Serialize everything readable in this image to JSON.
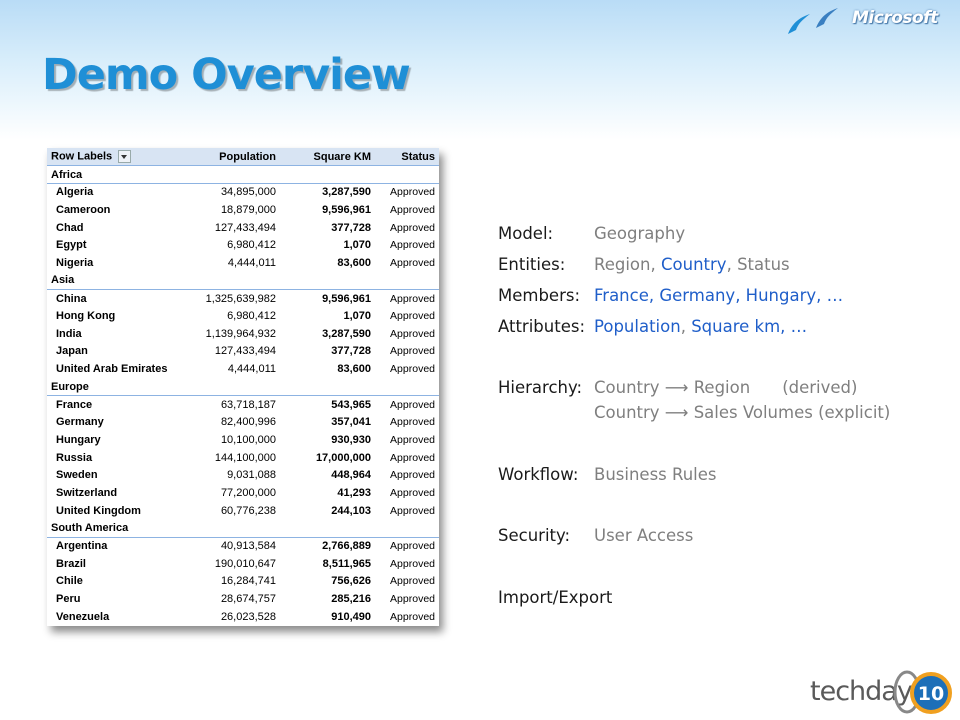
{
  "slide": {
    "title": "Demo Overview",
    "brand": "Microsoft",
    "event_logo": {
      "text": "techdays",
      "number": "10"
    }
  },
  "pivot": {
    "headers": [
      "Row Labels",
      "Population",
      "Square KM",
      "Status"
    ],
    "groups": [
      {
        "region": "Africa",
        "rows": [
          {
            "name": "Algeria",
            "population": "34,895,000",
            "area": "3,287,590",
            "status": "Approved"
          },
          {
            "name": "Cameroon",
            "population": "18,879,000",
            "area": "9,596,961",
            "status": "Approved"
          },
          {
            "name": "Chad",
            "population": "127,433,494",
            "area": "377,728",
            "status": "Approved"
          },
          {
            "name": "Egypt",
            "population": "6,980,412",
            "area": "1,070",
            "status": "Approved"
          },
          {
            "name": "Nigeria",
            "population": "4,444,011",
            "area": "83,600",
            "status": "Approved"
          }
        ]
      },
      {
        "region": "Asia",
        "rows": [
          {
            "name": "China",
            "population": "1,325,639,982",
            "area": "9,596,961",
            "status": "Approved"
          },
          {
            "name": "Hong Kong",
            "population": "6,980,412",
            "area": "1,070",
            "status": "Approved"
          },
          {
            "name": "India",
            "population": "1,139,964,932",
            "area": "3,287,590",
            "status": "Approved"
          },
          {
            "name": "Japan",
            "population": "127,433,494",
            "area": "377,728",
            "status": "Approved"
          },
          {
            "name": "United Arab Emirates",
            "population": "4,444,011",
            "area": "83,600",
            "status": "Approved"
          }
        ]
      },
      {
        "region": "Europe",
        "rows": [
          {
            "name": "France",
            "population": "63,718,187",
            "area": "543,965",
            "status": "Approved"
          },
          {
            "name": "Germany",
            "population": "82,400,996",
            "area": "357,041",
            "status": "Approved"
          },
          {
            "name": "Hungary",
            "population": "10,100,000",
            "area": "930,930",
            "status": "Approved"
          },
          {
            "name": "Russia",
            "population": "144,100,000",
            "area": "17,000,000",
            "status": "Approved"
          },
          {
            "name": "Sweden",
            "population": "9,031,088",
            "area": "448,964",
            "status": "Approved"
          },
          {
            "name": "Switzerland",
            "population": "77,200,000",
            "area": "41,293",
            "status": "Approved"
          },
          {
            "name": "United Kingdom",
            "population": "60,776,238",
            "area": "244,103",
            "status": "Approved"
          }
        ]
      },
      {
        "region": "South America",
        "rows": [
          {
            "name": "Argentina",
            "population": "40,913,584",
            "area": "2,766,889",
            "status": "Approved"
          },
          {
            "name": "Brazil",
            "population": "190,010,647",
            "area": "8,511,965",
            "status": "Approved"
          },
          {
            "name": "Chile",
            "population": "16,284,741",
            "area": "756,626",
            "status": "Approved"
          },
          {
            "name": "Peru",
            "population": "28,674,757",
            "area": "285,216",
            "status": "Approved"
          },
          {
            "name": "Venezuela",
            "population": "26,023,528",
            "area": "910,490",
            "status": "Approved"
          }
        ]
      }
    ]
  },
  "overview": {
    "model": {
      "label": "Model:",
      "value": "Geography"
    },
    "entities": {
      "label": "Entities:",
      "v1": "Region",
      "sep1": ",",
      "v2": "Country",
      "sep2": ",",
      "v3": "Status"
    },
    "members": {
      "label": "Members:",
      "value": "France, Germany, Hungary, …"
    },
    "attributes": {
      "label": "Attributes:",
      "v1": "Population",
      "sep": ",",
      "v2": "Square km, …"
    },
    "hierarchy": {
      "label": "Hierarchy:",
      "line1a": "Country ⟶ Region",
      "line1b": "(derived)",
      "line2": "Country ⟶ Sales Volumes (explicit)"
    },
    "workflow": {
      "label": "Workflow:",
      "value": "Business Rules"
    },
    "security": {
      "label": "Security:",
      "value": "User Access"
    },
    "import_export": {
      "label": "Import/Export"
    }
  },
  "colors": {
    "title": "#1f8fd6",
    "link": "#1f5ec9",
    "muted": "#7f7f7f",
    "header_bg": "#d8e4f3"
  }
}
